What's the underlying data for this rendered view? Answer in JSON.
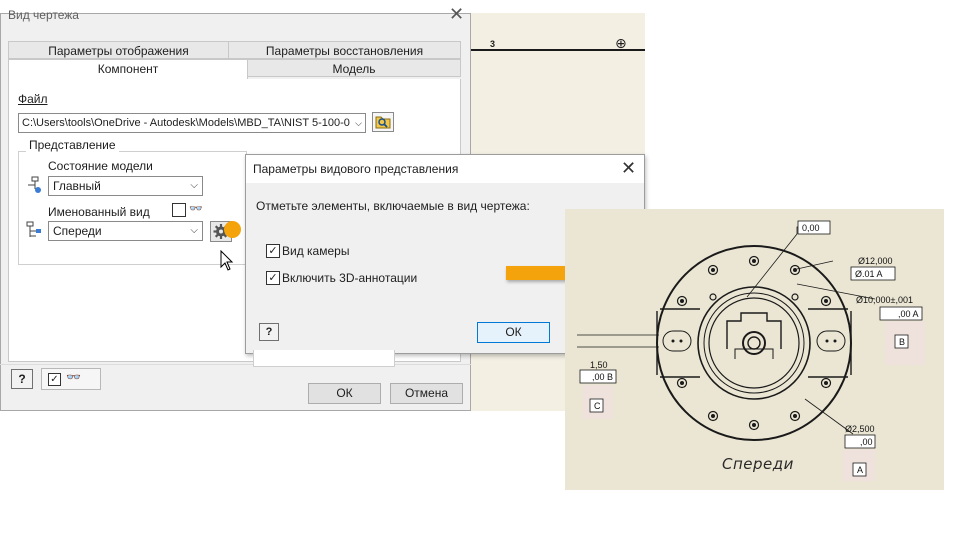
{
  "background_drawing": {
    "column_number": "3",
    "symbol": "⊕"
  },
  "main_dialog": {
    "title": "Вид чертежа",
    "tabs": [
      {
        "label": "Параметры отображения"
      },
      {
        "label": "Параметры восстановления"
      },
      {
        "label": "Компонент",
        "active": true
      },
      {
        "label": "Модель"
      }
    ],
    "file_label": "Файл",
    "file_path": "C:\\Users\\tools\\OneDrive - Autodesk\\Models\\MBD_TA\\NIST 5-100-0",
    "representation_label": "Представление",
    "model_state_label": "Состояние модели",
    "model_state_value": "Главный",
    "named_view_label": "Именованный вид",
    "named_view_value": "Спереди",
    "ok_label": "ОК",
    "cancel_label": "Отмена",
    "help_label": "?"
  },
  "sub_dialog": {
    "title": "Параметры видового представления",
    "prompt": "Отметьте элементы, включаемые в вид чертежа:",
    "checkbox_camera": {
      "label": "Вид камеры",
      "checked": true
    },
    "checkbox_3d": {
      "label": "Включить 3D-аннотации",
      "checked": true
    },
    "ok_label": "ОК",
    "help_label": "?"
  },
  "drawing_view": {
    "caption": "Спереди",
    "annotations": {
      "flatness": "0,00",
      "dia_12": "Ø12,000",
      "dia_12_tol": "Ø.01 A",
      "dia_10": "Ø10,000±,001",
      "dia_10_tol": ",00 A",
      "datum_b": "B",
      "dim_150": "1,50",
      "pos_tol": ",00 B",
      "datum_c": "C",
      "dia_25": "Ø2,500",
      "circ_tol": ",00",
      "datum_a": "A"
    }
  },
  "colors": {
    "accent_orange": "#f4a30a",
    "drawing_bg": "#ebe6d3",
    "ok_border": "#0078d7"
  }
}
